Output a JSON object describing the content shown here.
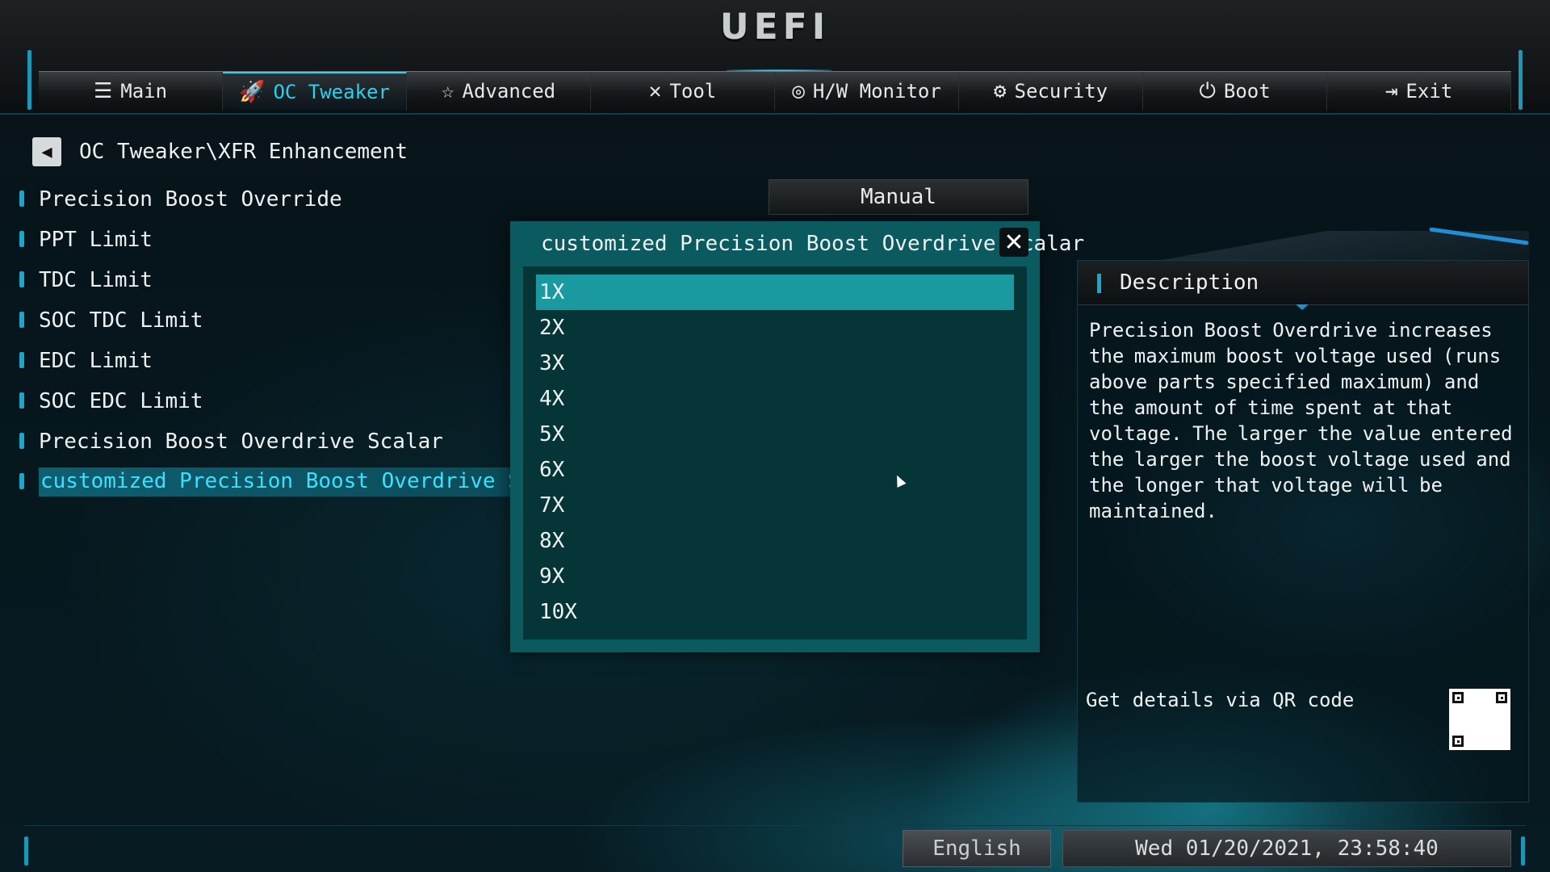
{
  "header": {
    "logo": "UEFI",
    "tabs": [
      {
        "label": "Main",
        "icon": "☰",
        "icon_name": "list-icon",
        "active": false
      },
      {
        "label": "OC Tweaker",
        "icon": "🚀",
        "icon_name": "rocket-icon",
        "active": true
      },
      {
        "label": "Advanced",
        "icon": "☆",
        "icon_name": "star-icon",
        "active": false
      },
      {
        "label": "Tool",
        "icon": "✕",
        "icon_name": "tools-icon",
        "active": false
      },
      {
        "label": "H/W Monitor",
        "icon": "◎",
        "icon_name": "monitor-gauge-icon",
        "active": false
      },
      {
        "label": "Security",
        "icon": "⚙",
        "icon_name": "shield-icon",
        "active": false
      },
      {
        "label": "Boot",
        "icon": "⏻",
        "icon_name": "power-icon",
        "active": false
      },
      {
        "label": "Exit",
        "icon": "⇥",
        "icon_name": "exit-door-icon",
        "active": false
      }
    ]
  },
  "breadcrumb": {
    "back_icon": "◀",
    "path": "OC Tweaker\\XFR Enhancement"
  },
  "menu": {
    "items": [
      {
        "label": "Precision Boost Override",
        "selected": false
      },
      {
        "label": "PPT Limit",
        "selected": false
      },
      {
        "label": "TDC Limit",
        "selected": false
      },
      {
        "label": "SOC TDC Limit",
        "selected": false
      },
      {
        "label": "EDC Limit",
        "selected": false
      },
      {
        "label": "SOC EDC Limit",
        "selected": false
      },
      {
        "label": "Precision Boost Overdrive Scalar",
        "selected": false
      },
      {
        "label": "customized Precision Boost Overdrive Scalar",
        "selected": true
      }
    ],
    "precision_boost_override_value": "Manual"
  },
  "popup": {
    "title": "customized Precision Boost Overdrive Scalar",
    "close_icon": "✕",
    "options": [
      "1X",
      "2X",
      "3X",
      "4X",
      "5X",
      "6X",
      "7X",
      "8X",
      "9X",
      "10X"
    ],
    "selected_index": 0
  },
  "description": {
    "title": "Description",
    "text": "Precision Boost Overdrive increases the maximum boost voltage used (runs above parts specified maximum) and the amount of time spent at that voltage. The larger the value entered the larger the boost voltage used and the longer that voltage will be maintained.",
    "qr_label": "Get details via QR code"
  },
  "footer": {
    "language": "English",
    "datetime": "Wed 01/20/2021, 23:58:40"
  },
  "colors": {
    "accent": "#28d2ee",
    "selection": "#1a99a0",
    "popup_bg": "#0a5a60",
    "list_bg": "#053536"
  }
}
